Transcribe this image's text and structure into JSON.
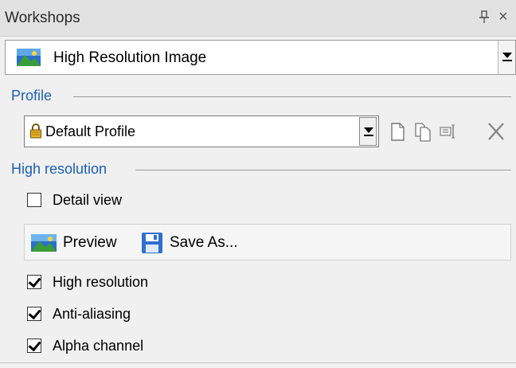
{
  "panel": {
    "title": "Workshops",
    "pin_icon": "pin-icon",
    "close_glyph": "×"
  },
  "workshop": {
    "selected": "High Resolution Image",
    "icon": "landscape-image-icon"
  },
  "profile": {
    "group_label": "Profile",
    "selected": "Default Profile",
    "lock_icon": "lock-icon",
    "buttons": [
      "new-profile-icon",
      "duplicate-profile-icon",
      "rename-profile-icon",
      "delete-profile-icon"
    ]
  },
  "high_resolution": {
    "group_label": "High resolution",
    "detail_view": {
      "label": "Detail view",
      "checked": false
    },
    "toolbar": {
      "preview_label": "Preview",
      "save_as_label": "Save As..."
    },
    "options": [
      {
        "label": "High resolution",
        "checked": true
      },
      {
        "label": "Anti-aliasing",
        "checked": true
      },
      {
        "label": "Alpha channel",
        "checked": true
      }
    ]
  },
  "colors": {
    "group_label": "#1a5fb4",
    "title_bar": "#e2e2e2",
    "background": "#f0f0f0"
  }
}
